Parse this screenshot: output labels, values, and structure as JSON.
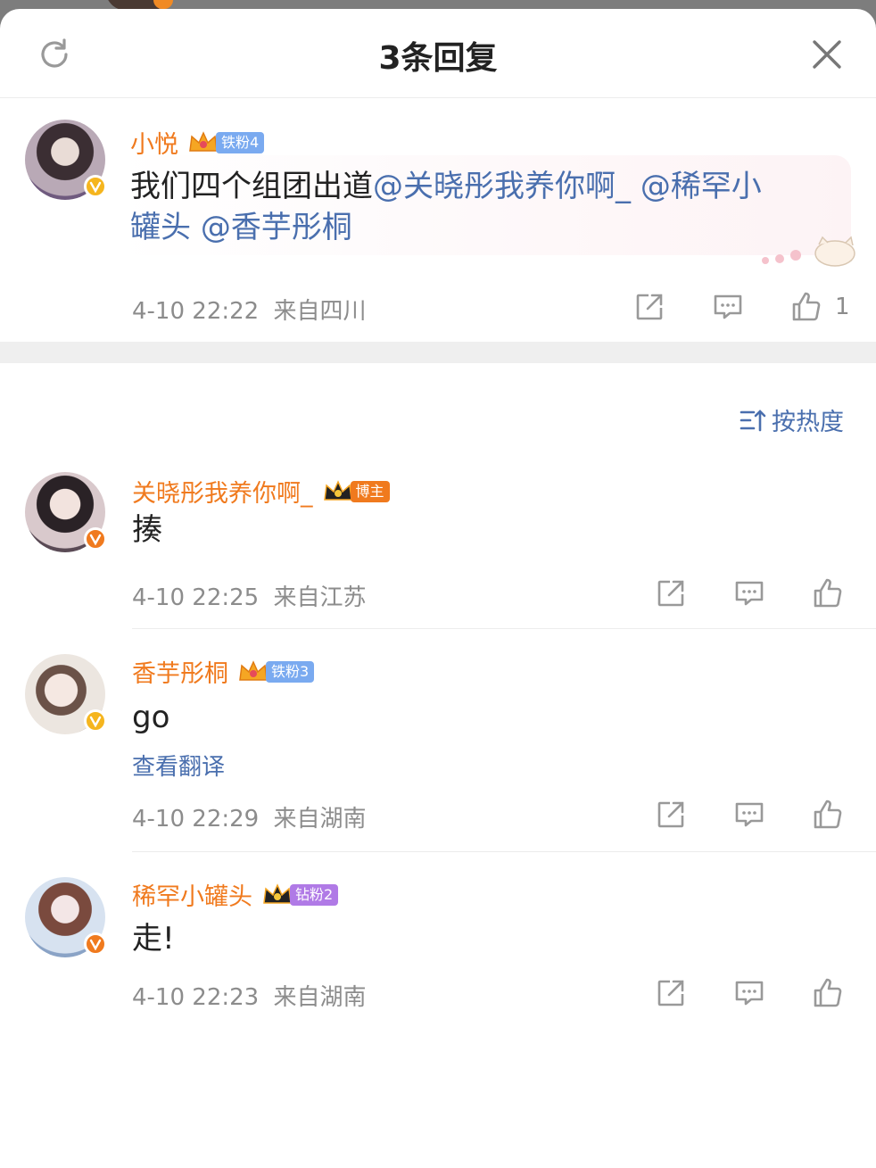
{
  "header": {
    "title": "3条回复"
  },
  "root_comment": {
    "username": "小悦",
    "fan_badge": "铁粉4",
    "text_plain": "我们四个组团出道",
    "mention_1": "@关晓彤我养你啊_",
    "mention_2_line1": "@稀罕小",
    "mention_2_line2": "罐头",
    "mention_3": "@香芋彤桐",
    "time": "4-10 22:22",
    "location": "来自四川",
    "like_count": "1"
  },
  "sort_label": "按热度",
  "replies": [
    {
      "username": "关晓彤我养你啊_",
      "fan_badge": "博主",
      "text": "揍",
      "time": "4-10 22:25",
      "location": "来自江苏"
    },
    {
      "username": "香芋彤桐",
      "fan_badge": "铁粉3",
      "text": "go",
      "translate": "查看翻译",
      "time": "4-10 22:29",
      "location": "来自湖南"
    },
    {
      "username": "稀罕小罐头",
      "fan_badge": "钻粉2",
      "text": "走!",
      "time": "4-10 22:23",
      "location": "来自湖南"
    }
  ],
  "colors": {
    "username": "#f07a1e",
    "mention": "#4a6fae",
    "meta": "#8c8c8c",
    "badge_iron": "#7aaaf0",
    "badge_host": "#f07a1e",
    "badge_diamond": "#b07ae6",
    "verified": "#f5b51e",
    "verified_orange": "#f07a1e"
  },
  "icons": [
    "refresh-icon",
    "close-icon",
    "share-icon",
    "comment-icon",
    "like-icon",
    "sort-icon",
    "crown-icon",
    "verified-icon"
  ]
}
